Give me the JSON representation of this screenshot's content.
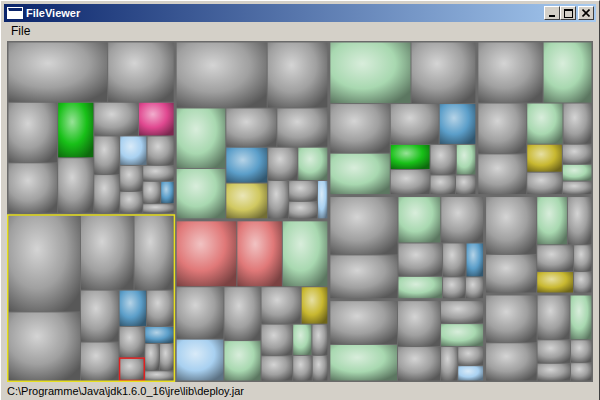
{
  "window": {
    "title": "FileViewer"
  },
  "menu": [
    {
      "label": "File"
    }
  ],
  "treemap": {
    "groups": [
      {
        "selected": false,
        "files": [
          {
            "size": 6,
            "color": "#a0a0a0",
            "selected": false
          },
          {
            "size": 4,
            "color": "#a0a0a0",
            "selected": false
          },
          {
            "size": 3,
            "color": "#a0a0a0",
            "selected": false
          },
          {
            "size": 2.5,
            "color": "#a0a0a0",
            "selected": false
          },
          {
            "size": 2,
            "color": "#18c018",
            "selected": false
          },
          {
            "size": 2,
            "color": "#a0a0a0",
            "selected": false
          },
          {
            "size": 1.5,
            "color": "#a0a0a0",
            "selected": false
          },
          {
            "size": 1.2,
            "color": "#e04890",
            "selected": false
          },
          {
            "size": 1,
            "color": "#a0a0a0",
            "selected": false
          },
          {
            "size": 1,
            "color": "#a0a0a0",
            "selected": false
          },
          {
            "size": 0.8,
            "color": "#a8d0f0",
            "selected": false
          },
          {
            "size": 0.8,
            "color": "#a0a0a0",
            "selected": false
          },
          {
            "size": 0.6,
            "color": "#a0a0a0",
            "selected": false
          },
          {
            "size": 0.5,
            "color": "#a0a0a0",
            "selected": false
          },
          {
            "size": 0.5,
            "color": "#a0a0a0",
            "selected": false
          },
          {
            "size": 0.4,
            "color": "#a0a0a0",
            "selected": false
          },
          {
            "size": 0.3,
            "color": "#5b9ec9",
            "selected": false
          },
          {
            "size": 0.3,
            "color": "#a0a0a0",
            "selected": false
          }
        ]
      },
      {
        "selected": true,
        "files": [
          {
            "size": 7,
            "color": "#a0a0a0",
            "selected": false
          },
          {
            "size": 5,
            "color": "#a0a0a0",
            "selected": false
          },
          {
            "size": 4,
            "color": "#a0a0a0",
            "selected": false
          },
          {
            "size": 3,
            "color": "#a0a0a0",
            "selected": false
          },
          {
            "size": 2,
            "color": "#a0a0a0",
            "selected": false
          },
          {
            "size": 1.5,
            "color": "#a0a0a0",
            "selected": false
          },
          {
            "size": 1,
            "color": "#5b9ec9",
            "selected": false
          },
          {
            "size": 1,
            "color": "#a0a0a0",
            "selected": false
          },
          {
            "size": 0.8,
            "color": "#a0a0a0",
            "selected": false
          },
          {
            "size": 0.6,
            "color": "#a0a0a0",
            "selected": true
          },
          {
            "size": 0.5,
            "color": "#5b9ec9",
            "selected": false
          },
          {
            "size": 0.4,
            "color": "#a0a0a0",
            "selected": false
          },
          {
            "size": 0.4,
            "color": "#a0a0a0",
            "selected": false
          },
          {
            "size": 0.3,
            "color": "#a0a0a0",
            "selected": false
          }
        ]
      },
      {
        "selected": false,
        "files": [
          {
            "size": 4,
            "color": "#e07878",
            "selected": false
          },
          {
            "size": 3,
            "color": "#e07878",
            "selected": false
          },
          {
            "size": 3,
            "color": "#a8d8b0",
            "selected": false
          },
          {
            "size": 2.5,
            "color": "#a0a0a0",
            "selected": false
          },
          {
            "size": 2,
            "color": "#a8d0f0",
            "selected": false
          },
          {
            "size": 2,
            "color": "#a0a0a0",
            "selected": false
          },
          {
            "size": 1.5,
            "color": "#a8d8b0",
            "selected": false
          },
          {
            "size": 1.5,
            "color": "#a0a0a0",
            "selected": false
          },
          {
            "size": 1,
            "color": "#c8b830",
            "selected": false
          },
          {
            "size": 1,
            "color": "#a0a0a0",
            "selected": false
          },
          {
            "size": 0.8,
            "color": "#a0a0a0",
            "selected": false
          },
          {
            "size": 0.6,
            "color": "#a8d8b0",
            "selected": false
          },
          {
            "size": 0.5,
            "color": "#a0a0a0",
            "selected": false
          },
          {
            "size": 0.5,
            "color": "#a0a0a0",
            "selected": false
          },
          {
            "size": 0.4,
            "color": "#a0a0a0",
            "selected": false
          }
        ]
      },
      {
        "selected": false,
        "files": [
          {
            "size": 6,
            "color": "#a0a0a0",
            "selected": false
          },
          {
            "size": 4,
            "color": "#a0a0a0",
            "selected": false
          },
          {
            "size": 3,
            "color": "#a8d8b0",
            "selected": false
          },
          {
            "size": 2.5,
            "color": "#a8d8b0",
            "selected": false
          },
          {
            "size": 2,
            "color": "#a0a0a0",
            "selected": false
          },
          {
            "size": 2,
            "color": "#a0a0a0",
            "selected": false
          },
          {
            "size": 1.5,
            "color": "#5b9ec9",
            "selected": false
          },
          {
            "size": 1.5,
            "color": "#d0c860",
            "selected": false
          },
          {
            "size": 1,
            "color": "#a0a0a0",
            "selected": false
          },
          {
            "size": 1,
            "color": "#a8d8b0",
            "selected": false
          },
          {
            "size": 0.8,
            "color": "#a0a0a0",
            "selected": false
          },
          {
            "size": 0.6,
            "color": "#a0a0a0",
            "selected": false
          },
          {
            "size": 0.5,
            "color": "#a0a0a0",
            "selected": false
          },
          {
            "size": 0.4,
            "color": "#a8d0f0",
            "selected": false
          }
        ]
      },
      {
        "selected": false,
        "files": [
          {
            "size": 5,
            "color": "#a8d8b0",
            "selected": false
          },
          {
            "size": 4,
            "color": "#a0a0a0",
            "selected": false
          },
          {
            "size": 3,
            "color": "#a0a0a0",
            "selected": false
          },
          {
            "size": 2.5,
            "color": "#a8d8b0",
            "selected": false
          },
          {
            "size": 2,
            "color": "#a0a0a0",
            "selected": false
          },
          {
            "size": 1.5,
            "color": "#5b9ec9",
            "selected": false
          },
          {
            "size": 1,
            "color": "#18c018",
            "selected": false
          },
          {
            "size": 1,
            "color": "#a0a0a0",
            "selected": false
          },
          {
            "size": 0.8,
            "color": "#a0a0a0",
            "selected": false
          },
          {
            "size": 0.6,
            "color": "#a8d8b0",
            "selected": false
          },
          {
            "size": 0.5,
            "color": "#a0a0a0",
            "selected": false
          },
          {
            "size": 0.4,
            "color": "#a0a0a0",
            "selected": false
          }
        ]
      },
      {
        "selected": false,
        "files": [
          {
            "size": 4,
            "color": "#a0a0a0",
            "selected": false
          },
          {
            "size": 3,
            "color": "#a8d8b0",
            "selected": false
          },
          {
            "size": 2.5,
            "color": "#a0a0a0",
            "selected": false
          },
          {
            "size": 2,
            "color": "#a0a0a0",
            "selected": false
          },
          {
            "size": 1.5,
            "color": "#a8d8b0",
            "selected": false
          },
          {
            "size": 1.2,
            "color": "#a0a0a0",
            "selected": false
          },
          {
            "size": 1,
            "color": "#c8b830",
            "selected": false
          },
          {
            "size": 0.8,
            "color": "#a0a0a0",
            "selected": false
          },
          {
            "size": 0.6,
            "color": "#a0a0a0",
            "selected": false
          },
          {
            "size": 0.5,
            "color": "#a8d8b0",
            "selected": false
          },
          {
            "size": 0.4,
            "color": "#a0a0a0",
            "selected": false
          }
        ]
      },
      {
        "selected": false,
        "files": [
          {
            "size": 4,
            "color": "#a0a0a0",
            "selected": false
          },
          {
            "size": 3,
            "color": "#a0a0a0",
            "selected": false
          },
          {
            "size": 2,
            "color": "#a8d8b0",
            "selected": false
          },
          {
            "size": 2,
            "color": "#a0a0a0",
            "selected": false
          },
          {
            "size": 1.5,
            "color": "#a0a0a0",
            "selected": false
          },
          {
            "size": 1,
            "color": "#a8d8b0",
            "selected": false
          },
          {
            "size": 0.8,
            "color": "#a0a0a0",
            "selected": false
          },
          {
            "size": 0.6,
            "color": "#5b9ec9",
            "selected": false
          },
          {
            "size": 0.5,
            "color": "#a0a0a0",
            "selected": false
          },
          {
            "size": 0.4,
            "color": "#a0a0a0",
            "selected": false
          }
        ]
      },
      {
        "selected": false,
        "files": [
          {
            "size": 3,
            "color": "#a0a0a0",
            "selected": false
          },
          {
            "size": 2.5,
            "color": "#a8d8b0",
            "selected": false
          },
          {
            "size": 2,
            "color": "#a0a0a0",
            "selected": false
          },
          {
            "size": 1.5,
            "color": "#a0a0a0",
            "selected": false
          },
          {
            "size": 1,
            "color": "#a0a0a0",
            "selected": false
          },
          {
            "size": 1,
            "color": "#a8d8b0",
            "selected": false
          },
          {
            "size": 0.6,
            "color": "#a0a0a0",
            "selected": false
          },
          {
            "size": 0.5,
            "color": "#a0a0a0",
            "selected": false
          },
          {
            "size": 0.4,
            "color": "#a8d0f0",
            "selected": false
          }
        ]
      },
      {
        "selected": false,
        "files": [
          {
            "size": 3,
            "color": "#a0a0a0",
            "selected": false
          },
          {
            "size": 2,
            "color": "#a0a0a0",
            "selected": false
          },
          {
            "size": 1.5,
            "color": "#a8d8b0",
            "selected": false
          },
          {
            "size": 1.2,
            "color": "#a0a0a0",
            "selected": false
          },
          {
            "size": 1,
            "color": "#a0a0a0",
            "selected": false
          },
          {
            "size": 0.8,
            "color": "#c8b830",
            "selected": false
          },
          {
            "size": 0.5,
            "color": "#a0a0a0",
            "selected": false
          },
          {
            "size": 0.4,
            "color": "#a0a0a0",
            "selected": false
          }
        ]
      },
      {
        "selected": false,
        "files": [
          {
            "size": 2.5,
            "color": "#a0a0a0",
            "selected": false
          },
          {
            "size": 2,
            "color": "#a0a0a0",
            "selected": false
          },
          {
            "size": 1.5,
            "color": "#a0a0a0",
            "selected": false
          },
          {
            "size": 1,
            "color": "#a8d8b0",
            "selected": false
          },
          {
            "size": 0.8,
            "color": "#a0a0a0",
            "selected": false
          },
          {
            "size": 0.6,
            "color": "#a0a0a0",
            "selected": false
          },
          {
            "size": 0.5,
            "color": "#a0a0a0",
            "selected": false
          },
          {
            "size": 0.4,
            "color": "#a0a0a0",
            "selected": false
          }
        ]
      }
    ]
  },
  "status_bar": "C:\\Programme\\Java\\jdk1.6.0_16\\jre\\lib\\deploy.jar"
}
